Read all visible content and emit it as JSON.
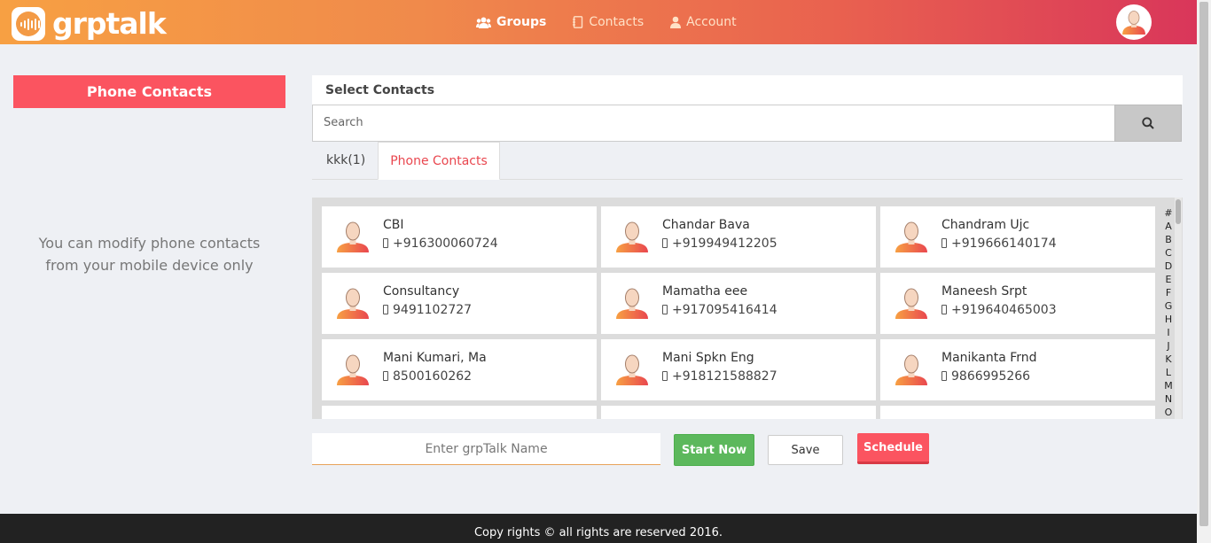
{
  "header": {
    "logo_text": "grptalk",
    "nav": [
      {
        "label": "Groups",
        "icon": "users-icon"
      },
      {
        "label": "Contacts",
        "icon": "address-book-icon"
      },
      {
        "label": "Account",
        "icon": "user-icon"
      }
    ],
    "colors": {
      "gradient_start": "#f7a043",
      "gradient_end": "#d9365a"
    }
  },
  "left_panel": {
    "title": "Phone Contacts",
    "note_line1": "You can modify phone contacts",
    "note_line2": "from your mobile device only"
  },
  "main": {
    "section_title": "Select Contacts",
    "search": {
      "placeholder": "Search"
    },
    "tabs": [
      {
        "label": "kkk(1)",
        "active": false
      },
      {
        "label": "Phone Contacts",
        "active": true
      }
    ],
    "contacts": [
      {
        "name": "CBI",
        "phone": "+916300060724"
      },
      {
        "name": "Chandar Bava",
        "phone": "+919949412205"
      },
      {
        "name": "Chandram Ujc",
        "phone": "+919666140174"
      },
      {
        "name": "Consultancy",
        "phone": "9491102727"
      },
      {
        "name": "Mamatha eee",
        "phone": "+917095416414"
      },
      {
        "name": "Maneesh Srpt",
        "phone": "+919640465003"
      },
      {
        "name": "Mani Kumari, Ma",
        "phone": "8500160262"
      },
      {
        "name": "Mani Spkn Eng",
        "phone": "+918121588827"
      },
      {
        "name": "Manikanta Frnd",
        "phone": "9866995266"
      }
    ],
    "alphabet": [
      "#",
      "A",
      "B",
      "C",
      "D",
      "E",
      "F",
      "G",
      "H",
      "I",
      "J",
      "K",
      "L",
      "M",
      "N",
      "O"
    ]
  },
  "actions": {
    "name_placeholder": "Enter grpTalk Name",
    "start_label": "Start Now",
    "save_label": "Save",
    "schedule_label": "Schedule"
  },
  "footer": {
    "text": "Copy rights © all rights are reserved 2016."
  }
}
